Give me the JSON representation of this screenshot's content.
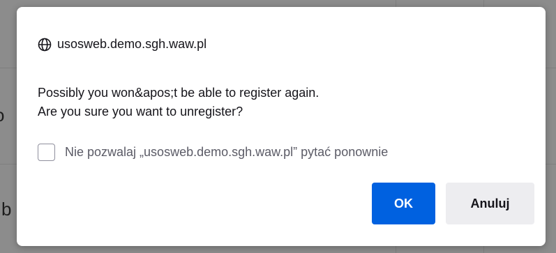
{
  "background": {
    "fragments": [
      "o",
      "b"
    ]
  },
  "dialog": {
    "origin": "usosweb.demo.sgh.waw.pl",
    "origin_icon": "globe-icon",
    "message_line1": "Possibly you won&apos;t be able to register again.",
    "message_line2": "Are you sure you want to unregister?",
    "checkbox_label": "Nie pozwalaj „usosweb.demo.sgh.waw.pl” pytać ponownie",
    "checkbox_checked": false,
    "ok_label": "OK",
    "cancel_label": "Anuluj"
  },
  "colors": {
    "primary": "#0061e0",
    "secondary_button": "#ededf0",
    "text": "#15141a",
    "muted_text": "#5b5b66"
  }
}
